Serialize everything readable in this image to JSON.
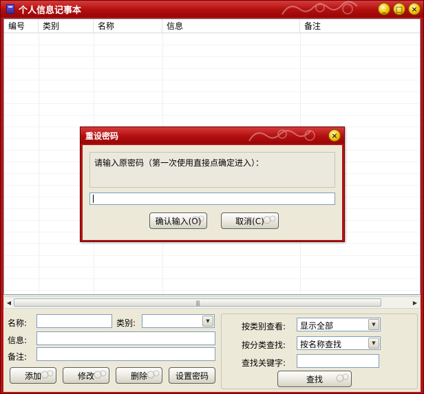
{
  "window": {
    "title": "个人信息记事本",
    "controls": {
      "minimize": "_",
      "maximize": "□",
      "close": "×"
    }
  },
  "list": {
    "columns": [
      "编号",
      "类别",
      "名称",
      "信息",
      "备注"
    ],
    "rows": []
  },
  "scrollbar": {
    "left_arrow": "◀",
    "right_arrow": "▶",
    "grip": "|||"
  },
  "form": {
    "name_label": "名称:",
    "name_value": "",
    "category_label": "类别:",
    "category_value": "",
    "info_label": "信息:",
    "info_value": "",
    "note_label": "备注:",
    "note_value": "",
    "buttons": {
      "add": "添加",
      "edit": "修改",
      "delete": "删除",
      "set_password": "设置密码"
    }
  },
  "filter": {
    "by_category_label": "按类别查看:",
    "by_category_value": "显示全部",
    "search_by_label": "按分类查找:",
    "search_by_value": "按名称查找",
    "keyword_label": "查找关键字:",
    "keyword_value": "",
    "search_button": "查找"
  },
  "dialog": {
    "title": "重设密码",
    "close": "×",
    "message": "请输入原密码（第一次使用直接点确定进入）：",
    "input_value": "",
    "confirm_button": "确认输入(O)",
    "cancel_button": "取消(C)"
  },
  "colors": {
    "titlebar": "#b20f0f",
    "frame": "#b31313",
    "client": "#ece9d8",
    "control_button": "#f0c000"
  }
}
